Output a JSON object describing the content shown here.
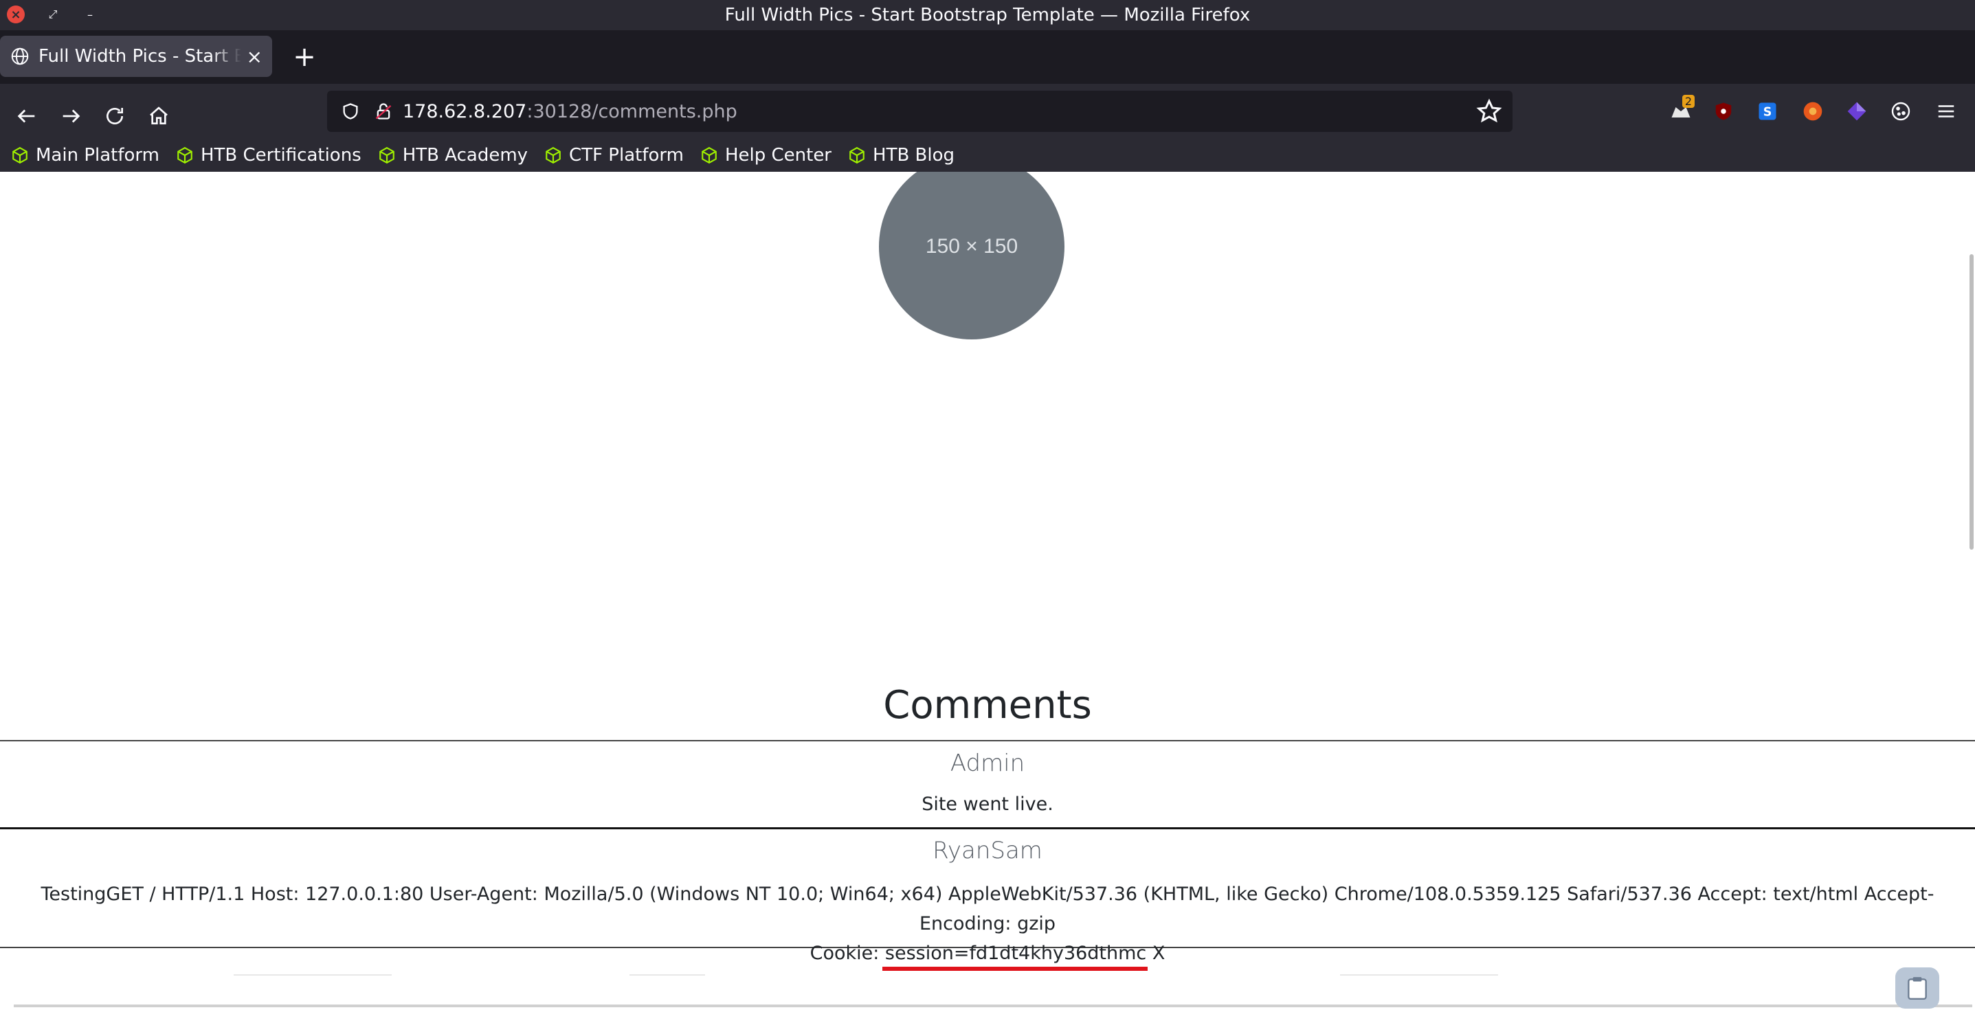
{
  "window": {
    "title": "Full Width Pics - Start Bootstrap Template — Mozilla Firefox"
  },
  "tab": {
    "title": "Full Width Pics - Start Bootstrap Template",
    "close_label": "×",
    "new_tab_label": "+"
  },
  "urlbar": {
    "host": "178.62.8.207",
    "rest": ":30128/comments.php"
  },
  "extensions": {
    "badge_count": "2"
  },
  "bookmarks": [
    {
      "label": "Main Platform"
    },
    {
      "label": "HTB Certifications"
    },
    {
      "label": "HTB Academy"
    },
    {
      "label": "CTF Platform"
    },
    {
      "label": "Help Center"
    },
    {
      "label": "HTB Blog"
    }
  ],
  "page": {
    "placeholder_text": "150 × 150",
    "comments_heading": "Comments",
    "comments": [
      {
        "author": "Admin",
        "body": "Site went live."
      },
      {
        "author": "RyanSam",
        "body_line1": "TestingGET / HTTP/1.1 Host: 127.0.0.1:80 User-Agent: Mozilla/5.0 (Windows NT 10.0; Win64; x64) AppleWebKit/537.36 (KHTML, like Gecko) Chrome/108.0.5359.125 Safari/537.36 Accept: text/html Accept-Encoding: gzip",
        "body_line2_prefix": "Cookie: ",
        "body_session": "session=fd1dt4khy36dthmc",
        "body_line2_suffix": " X"
      }
    ]
  },
  "colors": {
    "chrome_dark": "#2b2a33",
    "tabbar": "#1c1b22",
    "bookmark_icon": "#9fef00",
    "highlight_underline": "#e0141c",
    "placeholder_circle": "#6c757d"
  }
}
